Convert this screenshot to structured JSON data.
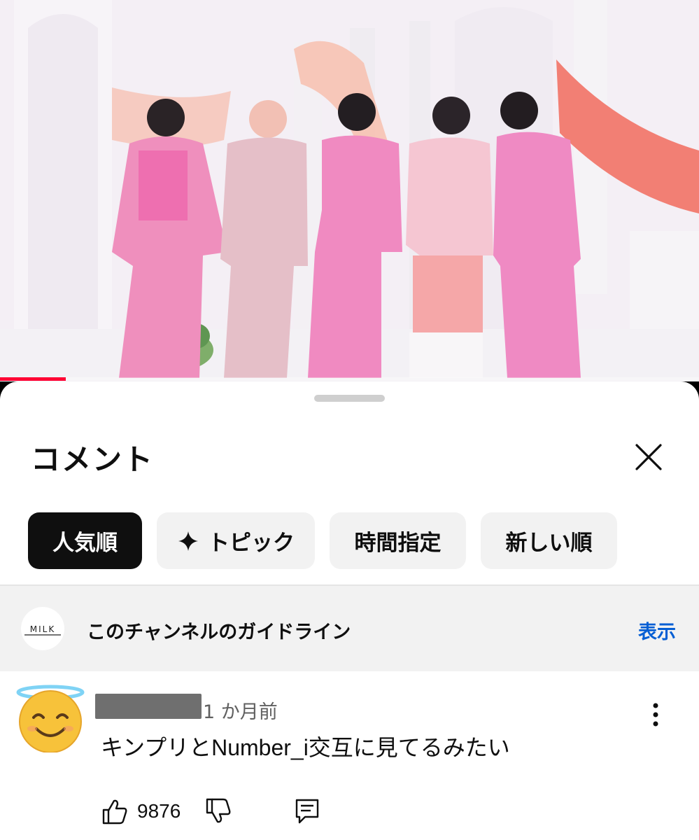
{
  "video": {
    "description_icon": "pink-suits-group-thumbnail",
    "accent_color": "#ff0033",
    "progress": 0.094
  },
  "comments_panel": {
    "title": "コメント",
    "close_icon": "close-icon",
    "chips": [
      {
        "label": "人気順",
        "active": true
      },
      {
        "label": "トピック",
        "icon": "sparkle-icon",
        "active": false
      },
      {
        "label": "時間指定",
        "active": false
      },
      {
        "label": "新しい順",
        "active": false
      }
    ],
    "guideline": {
      "channel_logo_text": "MILK",
      "text": "このチャンネルのガイドライン",
      "action": "表示"
    },
    "comment": {
      "avatar_icon": "smiling-face-with-halo-emoji",
      "time": "1 か月前",
      "text": "キンプリとNumber_i交互に見てるみたい",
      "like_count": "9876"
    }
  }
}
